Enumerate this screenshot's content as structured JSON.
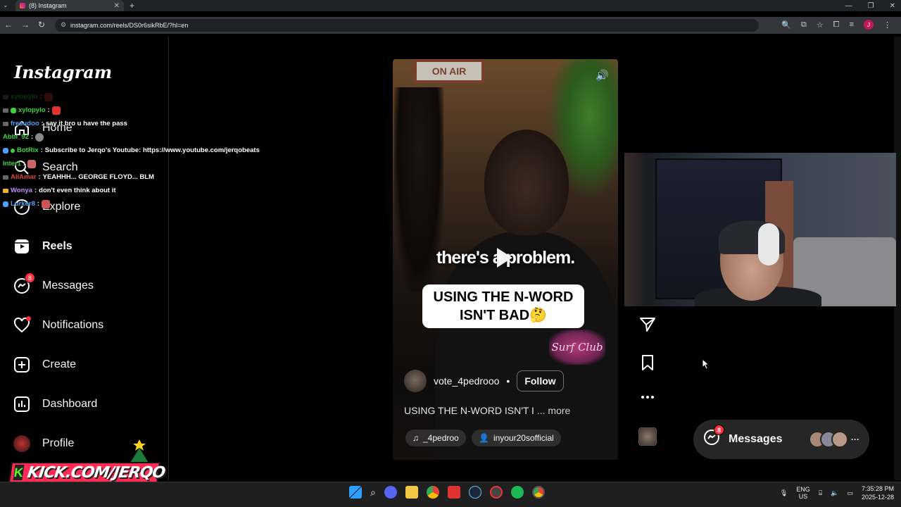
{
  "browser": {
    "tab_title": "(8) Instagram",
    "new_tab": "+",
    "url": "instagram.com/reels/DS0r6sikRbE/?hl=en",
    "profile_initial": "J"
  },
  "sidebar": {
    "logo": "Instagram",
    "items": [
      {
        "label": "Home",
        "icon": "home-icon"
      },
      {
        "label": "Search",
        "icon": "search-icon"
      },
      {
        "label": "Explore",
        "icon": "compass-icon"
      },
      {
        "label": "Reels",
        "icon": "reels-icon"
      },
      {
        "label": "Messages",
        "icon": "messenger-icon",
        "badge": "8"
      },
      {
        "label": "Notifications",
        "icon": "heart-icon"
      },
      {
        "label": "Create",
        "icon": "plus-square-icon"
      },
      {
        "label": "Dashboard",
        "icon": "chart-icon"
      },
      {
        "label": "Profile",
        "icon": "avatar"
      }
    ]
  },
  "chat": [
    {
      "user": "xylopylo",
      "color": "#3cd33c",
      "msg": ""
    },
    {
      "user": "xylopylo",
      "color": "#3cd33c",
      "msg": ""
    },
    {
      "user": "fresudoo",
      "color": "#4aa3ff",
      "msg": "say it bro u have the pass"
    },
    {
      "user": "Abbi_92",
      "color": "#3cd33c",
      "msg": ""
    },
    {
      "user": "BotRix",
      "color": "#3cd33c",
      "msg": "Subscribe to Jerqo's Youtube: https://www.youtube.com/jerqobeats"
    },
    {
      "user": "Inter1",
      "color": "#3cd33c",
      "msg": ""
    },
    {
      "user": "AliAmar",
      "color": "#e0423c",
      "msg": "YEAHHH... GEORGE FLOYD... BLM"
    },
    {
      "user": "Wonya",
      "color": "#c58cff",
      "msg": "don't even think about it"
    },
    {
      "user": "Lurker8",
      "color": "#4aa3ff",
      "msg": ""
    }
  ],
  "reel": {
    "caption_top": "there's a problem.",
    "caption_box": "USING THE N-WORD ISN'T BAD🤔",
    "sign": "Surf Club",
    "onair": "ON AIR",
    "author": "vote_4pedrooo",
    "separator": "•",
    "follow": "Follow",
    "description": "USING THE N-WORD ISN'T I",
    "more": "... more",
    "audio": "_4pedroo",
    "tagged": "inyour20sofficial"
  },
  "messages_pill": {
    "label": "Messages",
    "badge": "8",
    "more": "···"
  },
  "overlay": {
    "kick": "KICK.COM/JERQO"
  },
  "taskbar": {
    "lang1": "ENG",
    "lang2": "US",
    "time": "7:35:28 PM",
    "date": "2025-12-28"
  }
}
